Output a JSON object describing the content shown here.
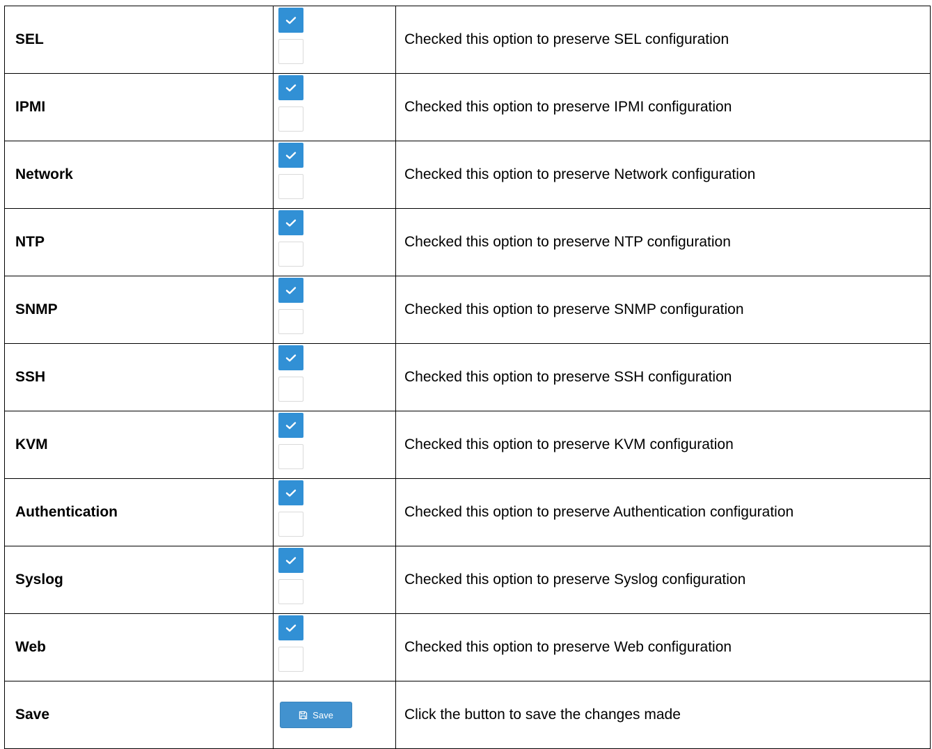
{
  "rows": [
    {
      "label": "SEL",
      "checked": true,
      "description": "Checked this option to preserve SEL configuration"
    },
    {
      "label": "IPMI",
      "checked": true,
      "description": "Checked this option to preserve IPMI configuration"
    },
    {
      "label": "Network",
      "checked": true,
      "description": "Checked this option to preserve Network configuration"
    },
    {
      "label": "NTP",
      "checked": true,
      "description": "Checked this option to preserve NTP configuration"
    },
    {
      "label": "SNMP",
      "checked": true,
      "description": "Checked this option to preserve SNMP configuration"
    },
    {
      "label": "SSH",
      "checked": true,
      "description": "Checked this option to preserve SSH configuration"
    },
    {
      "label": "KVM",
      "checked": true,
      "description": "Checked this option to preserve KVM configuration"
    },
    {
      "label": "Authentication",
      "checked": true,
      "description": "Checked this option to preserve Authentication configuration"
    },
    {
      "label": "Syslog",
      "checked": true,
      "description": "Checked this option to preserve Syslog configuration"
    },
    {
      "label": "Web",
      "checked": true,
      "description": "Checked this option to preserve Web configuration"
    }
  ],
  "save_row": {
    "label": "Save",
    "button_label": "Save",
    "button_icon": "floppy-disk-icon",
    "description": "Click the button to save the changes made"
  },
  "colors": {
    "checkbox_checked": "#3190d5",
    "button": "#4292cf"
  }
}
